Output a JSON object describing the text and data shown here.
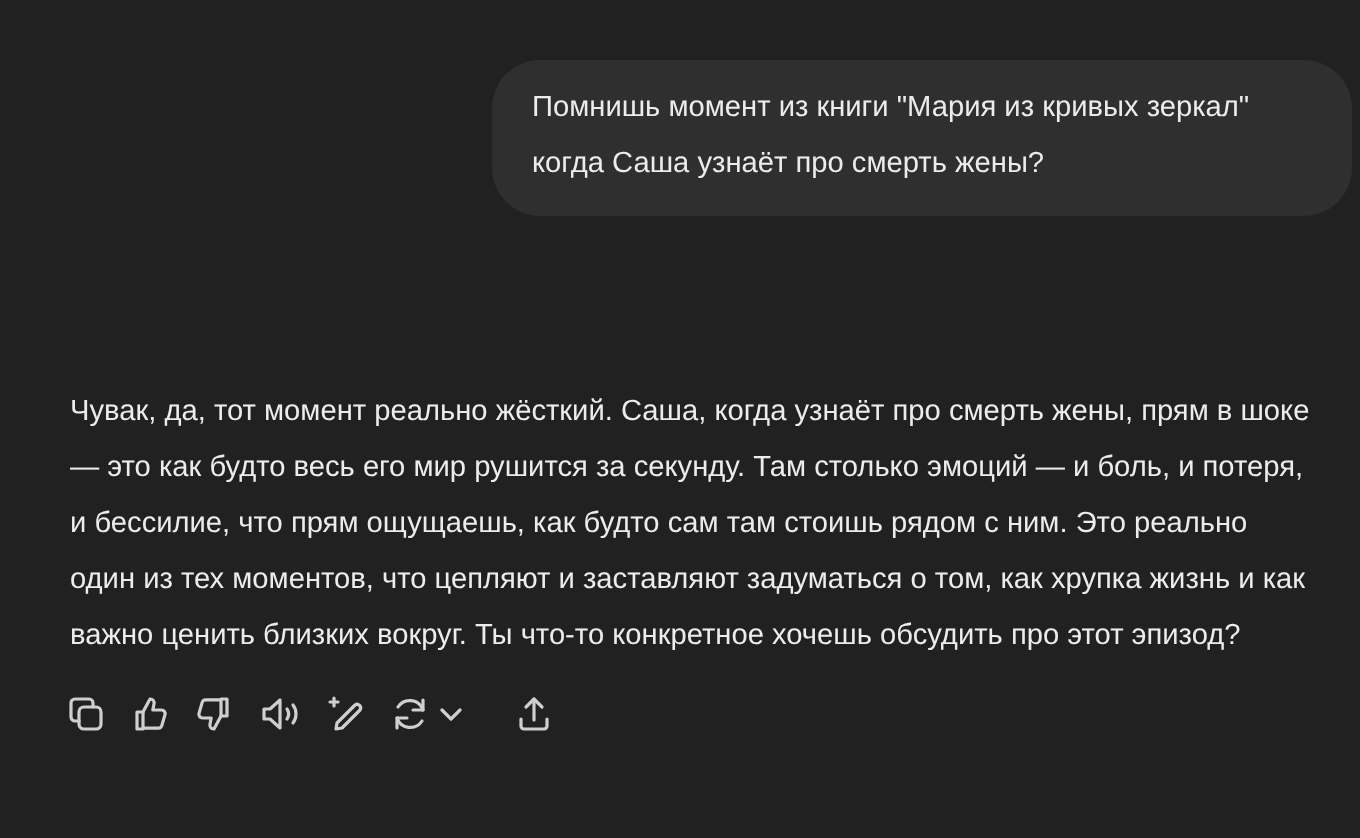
{
  "user_message": {
    "text": "Помнишь момент из книги \"Мария из кривых зеркал\" когда Саша узнаёт про смерть жены?"
  },
  "assistant_message": {
    "text": "Чувак, да, тот момент реально жёсткий. Саша, когда узнаёт про смерть жены, прям в шоке — это как будто весь его мир рушится за секунду. Там столько эмоций — и боль, и потеря, и бессилие, что прям ощущаешь, как будто сам там стоишь рядом с ним. Это реально один из тех моментов, что цепляют и заставляют задуматься о том, как хрупка жизнь и как важно ценить близких вокруг. Ты что-то конкретное хочешь обсудить про этот эпизод?"
  },
  "actions": [
    {
      "kind": "copy"
    },
    {
      "kind": "like"
    },
    {
      "kind": "dislike"
    },
    {
      "kind": "speak"
    },
    {
      "kind": "edit"
    },
    {
      "kind": "regenerate"
    },
    {
      "kind": "share"
    }
  ]
}
